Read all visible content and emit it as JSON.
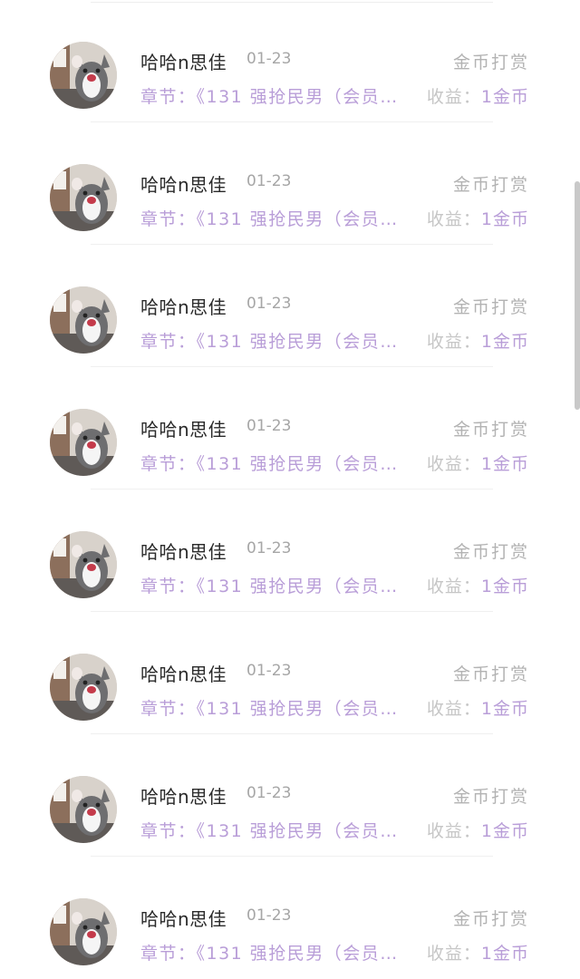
{
  "records": [
    {
      "name": "哈哈n思佳",
      "date": "01-23",
      "type": "金币打赏",
      "chapter": "章节：《131 强抢民男（会员…",
      "earn_label": "收益：",
      "earn_value": "1金币"
    },
    {
      "name": "哈哈n思佳",
      "date": "01-23",
      "type": "金币打赏",
      "chapter": "章节：《131 强抢民男（会员…",
      "earn_label": "收益：",
      "earn_value": "1金币"
    },
    {
      "name": "哈哈n思佳",
      "date": "01-23",
      "type": "金币打赏",
      "chapter": "章节：《131 强抢民男（会员…",
      "earn_label": "收益：",
      "earn_value": "1金币"
    },
    {
      "name": "哈哈n思佳",
      "date": "01-23",
      "type": "金币打赏",
      "chapter": "章节：《131 强抢民男（会员…",
      "earn_label": "收益：",
      "earn_value": "1金币"
    },
    {
      "name": "哈哈n思佳",
      "date": "01-23",
      "type": "金币打赏",
      "chapter": "章节：《131 强抢民男（会员…",
      "earn_label": "收益：",
      "earn_value": "1金币"
    },
    {
      "name": "哈哈n思佳",
      "date": "01-23",
      "type": "金币打赏",
      "chapter": "章节：《131 强抢民男（会员…",
      "earn_label": "收益：",
      "earn_value": "1金币"
    },
    {
      "name": "哈哈n思佳",
      "date": "01-23",
      "type": "金币打赏",
      "chapter": "章节：《131 强抢民男（会员…",
      "earn_label": "收益：",
      "earn_value": "1金币"
    },
    {
      "name": "哈哈n思佳",
      "date": "01-23",
      "type": "金币打赏",
      "chapter": "章节：《131 强抢民男（会员…",
      "earn_label": "收益：",
      "earn_value": "1金币"
    }
  ],
  "colors": {
    "accent": "#b99ed8",
    "muted": "#b3b3b3",
    "name": "#2a2a2a"
  },
  "icons": {
    "avatar": "cat-avatar-icon"
  }
}
